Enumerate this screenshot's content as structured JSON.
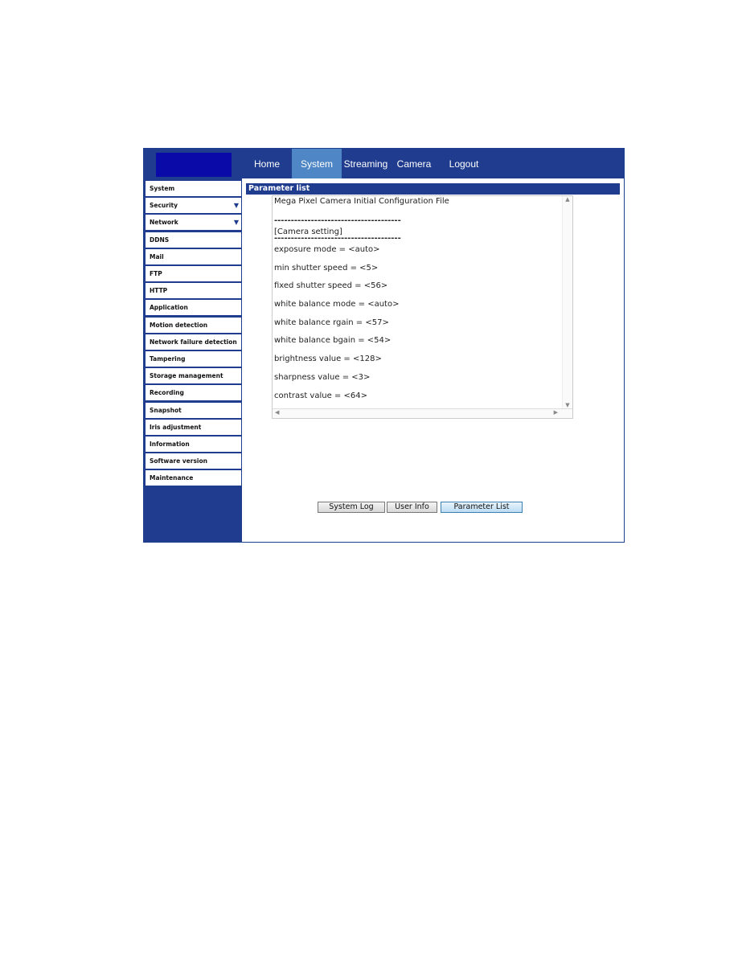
{
  "nav": [
    "Home",
    "System",
    "Streaming",
    "Camera",
    "Logout"
  ],
  "nav_active": "System",
  "sidebar": [
    {
      "label": "System"
    },
    {
      "label": "Security",
      "arrow": true
    },
    {
      "label": "Network",
      "arrow": true
    },
    {
      "label": "DDNS"
    },
    {
      "label": "Mail"
    },
    {
      "label": "FTP"
    },
    {
      "label": "HTTP"
    },
    {
      "label": "Application"
    },
    {
      "label": "Motion detection"
    },
    {
      "label": "Network failure detection"
    },
    {
      "label": "Tampering"
    },
    {
      "label": "Storage management"
    },
    {
      "label": "Recording"
    },
    {
      "label": "Snapshot"
    },
    {
      "label": "Iris adjustment"
    },
    {
      "label": "Information"
    },
    {
      "label": "Software version"
    },
    {
      "label": "Maintenance"
    }
  ],
  "panel_title": "Parameter list",
  "parameter_lines": [
    "Mega Pixel Camera Initial Configuration File",
    "",
    "--------------------------------------",
    "[Camera setting]",
    "--------------------------------------",
    "exposure mode = <auto>",
    "min shutter speed = <5>",
    "fixed shutter speed = <56>",
    "white balance mode = <auto>",
    "white balance rgain = <57>",
    "white balance bgain = <54>",
    "brightness value = <128>",
    "sharpness value = <3>",
    "contrast value = <64>"
  ],
  "buttons": [
    "System Log",
    "User Info",
    "Parameter List"
  ],
  "active_button": "Parameter List",
  "colors": {
    "header": "#1f3c8f",
    "nav_active": "#4f86c6",
    "logo": "#0a0aa8"
  }
}
